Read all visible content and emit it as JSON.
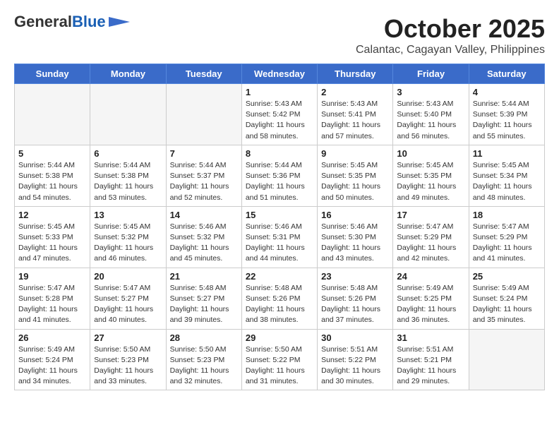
{
  "header": {
    "logo_line1": "General",
    "logo_line2": "Blue",
    "month": "October 2025",
    "location": "Calantac, Cagayan Valley, Philippines"
  },
  "weekdays": [
    "Sunday",
    "Monday",
    "Tuesday",
    "Wednesday",
    "Thursday",
    "Friday",
    "Saturday"
  ],
  "weeks": [
    [
      {
        "day": "",
        "info": "",
        "empty": true
      },
      {
        "day": "",
        "info": "",
        "empty": true
      },
      {
        "day": "",
        "info": "",
        "empty": true
      },
      {
        "day": "1",
        "info": "Sunrise: 5:43 AM\nSunset: 5:42 PM\nDaylight: 11 hours\nand 58 minutes."
      },
      {
        "day": "2",
        "info": "Sunrise: 5:43 AM\nSunset: 5:41 PM\nDaylight: 11 hours\nand 57 minutes."
      },
      {
        "day": "3",
        "info": "Sunrise: 5:43 AM\nSunset: 5:40 PM\nDaylight: 11 hours\nand 56 minutes."
      },
      {
        "day": "4",
        "info": "Sunrise: 5:44 AM\nSunset: 5:39 PM\nDaylight: 11 hours\nand 55 minutes."
      }
    ],
    [
      {
        "day": "5",
        "info": "Sunrise: 5:44 AM\nSunset: 5:38 PM\nDaylight: 11 hours\nand 54 minutes."
      },
      {
        "day": "6",
        "info": "Sunrise: 5:44 AM\nSunset: 5:38 PM\nDaylight: 11 hours\nand 53 minutes."
      },
      {
        "day": "7",
        "info": "Sunrise: 5:44 AM\nSunset: 5:37 PM\nDaylight: 11 hours\nand 52 minutes."
      },
      {
        "day": "8",
        "info": "Sunrise: 5:44 AM\nSunset: 5:36 PM\nDaylight: 11 hours\nand 51 minutes."
      },
      {
        "day": "9",
        "info": "Sunrise: 5:45 AM\nSunset: 5:35 PM\nDaylight: 11 hours\nand 50 minutes."
      },
      {
        "day": "10",
        "info": "Sunrise: 5:45 AM\nSunset: 5:35 PM\nDaylight: 11 hours\nand 49 minutes."
      },
      {
        "day": "11",
        "info": "Sunrise: 5:45 AM\nSunset: 5:34 PM\nDaylight: 11 hours\nand 48 minutes."
      }
    ],
    [
      {
        "day": "12",
        "info": "Sunrise: 5:45 AM\nSunset: 5:33 PM\nDaylight: 11 hours\nand 47 minutes."
      },
      {
        "day": "13",
        "info": "Sunrise: 5:45 AM\nSunset: 5:32 PM\nDaylight: 11 hours\nand 46 minutes."
      },
      {
        "day": "14",
        "info": "Sunrise: 5:46 AM\nSunset: 5:32 PM\nDaylight: 11 hours\nand 45 minutes."
      },
      {
        "day": "15",
        "info": "Sunrise: 5:46 AM\nSunset: 5:31 PM\nDaylight: 11 hours\nand 44 minutes."
      },
      {
        "day": "16",
        "info": "Sunrise: 5:46 AM\nSunset: 5:30 PM\nDaylight: 11 hours\nand 43 minutes."
      },
      {
        "day": "17",
        "info": "Sunrise: 5:47 AM\nSunset: 5:29 PM\nDaylight: 11 hours\nand 42 minutes."
      },
      {
        "day": "18",
        "info": "Sunrise: 5:47 AM\nSunset: 5:29 PM\nDaylight: 11 hours\nand 41 minutes."
      }
    ],
    [
      {
        "day": "19",
        "info": "Sunrise: 5:47 AM\nSunset: 5:28 PM\nDaylight: 11 hours\nand 41 minutes."
      },
      {
        "day": "20",
        "info": "Sunrise: 5:47 AM\nSunset: 5:27 PM\nDaylight: 11 hours\nand 40 minutes."
      },
      {
        "day": "21",
        "info": "Sunrise: 5:48 AM\nSunset: 5:27 PM\nDaylight: 11 hours\nand 39 minutes."
      },
      {
        "day": "22",
        "info": "Sunrise: 5:48 AM\nSunset: 5:26 PM\nDaylight: 11 hours\nand 38 minutes."
      },
      {
        "day": "23",
        "info": "Sunrise: 5:48 AM\nSunset: 5:26 PM\nDaylight: 11 hours\nand 37 minutes."
      },
      {
        "day": "24",
        "info": "Sunrise: 5:49 AM\nSunset: 5:25 PM\nDaylight: 11 hours\nand 36 minutes."
      },
      {
        "day": "25",
        "info": "Sunrise: 5:49 AM\nSunset: 5:24 PM\nDaylight: 11 hours\nand 35 minutes."
      }
    ],
    [
      {
        "day": "26",
        "info": "Sunrise: 5:49 AM\nSunset: 5:24 PM\nDaylight: 11 hours\nand 34 minutes."
      },
      {
        "day": "27",
        "info": "Sunrise: 5:50 AM\nSunset: 5:23 PM\nDaylight: 11 hours\nand 33 minutes."
      },
      {
        "day": "28",
        "info": "Sunrise: 5:50 AM\nSunset: 5:23 PM\nDaylight: 11 hours\nand 32 minutes."
      },
      {
        "day": "29",
        "info": "Sunrise: 5:50 AM\nSunset: 5:22 PM\nDaylight: 11 hours\nand 31 minutes."
      },
      {
        "day": "30",
        "info": "Sunrise: 5:51 AM\nSunset: 5:22 PM\nDaylight: 11 hours\nand 30 minutes."
      },
      {
        "day": "31",
        "info": "Sunrise: 5:51 AM\nSunset: 5:21 PM\nDaylight: 11 hours\nand 29 minutes."
      },
      {
        "day": "",
        "info": "",
        "empty": true
      }
    ]
  ]
}
